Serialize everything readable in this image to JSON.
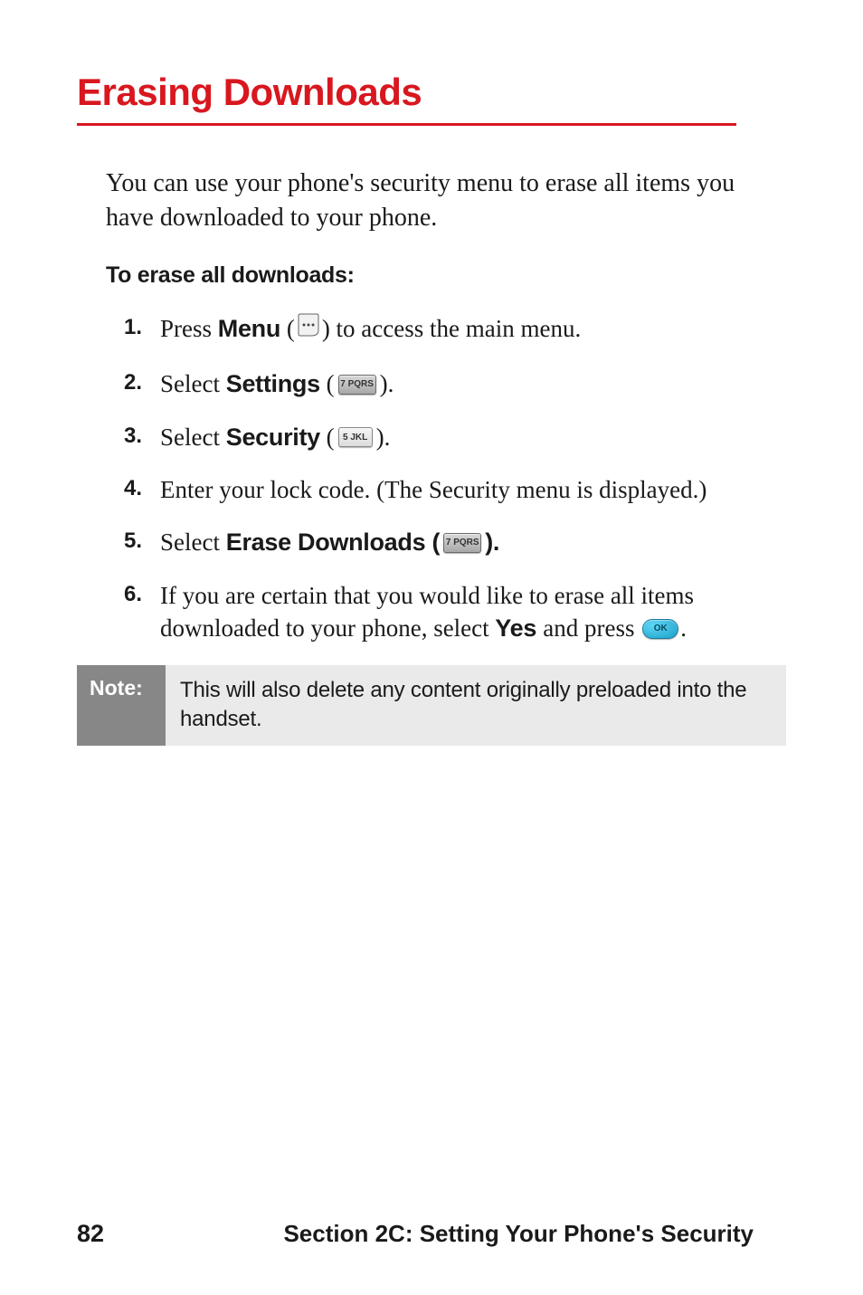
{
  "title": "Erasing Downloads",
  "intro": "You can use your phone's security menu to erase all items you have downloaded to your phone.",
  "sub_heading": "To erase all downloads:",
  "steps": {
    "s1": {
      "num": "1.",
      "pre": "Press ",
      "bold": "Menu",
      "post1": " (",
      "post2": ") to access the main menu."
    },
    "s2": {
      "num": "2.",
      "pre": "Select ",
      "bold": "Settings",
      "post1": " (",
      "post2": ")."
    },
    "s3": {
      "num": "3.",
      "pre": "Select ",
      "bold": "Security",
      "post1": " (",
      "post2": ")."
    },
    "s4": {
      "num": "4.",
      "text": "Enter your lock code. (The Security menu is displayed.)"
    },
    "s5": {
      "num": "5.",
      "pre": "Select ",
      "bold": "Erase Downloads",
      "post1": " (",
      "post2": ")."
    },
    "s6": {
      "num": "6.",
      "pre": "If you are certain that you would like to erase all items downloaded to your phone, select ",
      "bold": "Yes ",
      "post1": "and press ",
      "post2": "."
    }
  },
  "note": {
    "label": "Note:",
    "text": "This will also delete any content originally preloaded into the handset."
  },
  "footer": {
    "page_number": "82",
    "section_title": "Section 2C: Setting Your Phone's Security"
  },
  "icons": {
    "menu_key": "menu-soft-key-icon",
    "key7": "7 PQRS",
    "key5": "5 JKL",
    "ok": "OK"
  }
}
